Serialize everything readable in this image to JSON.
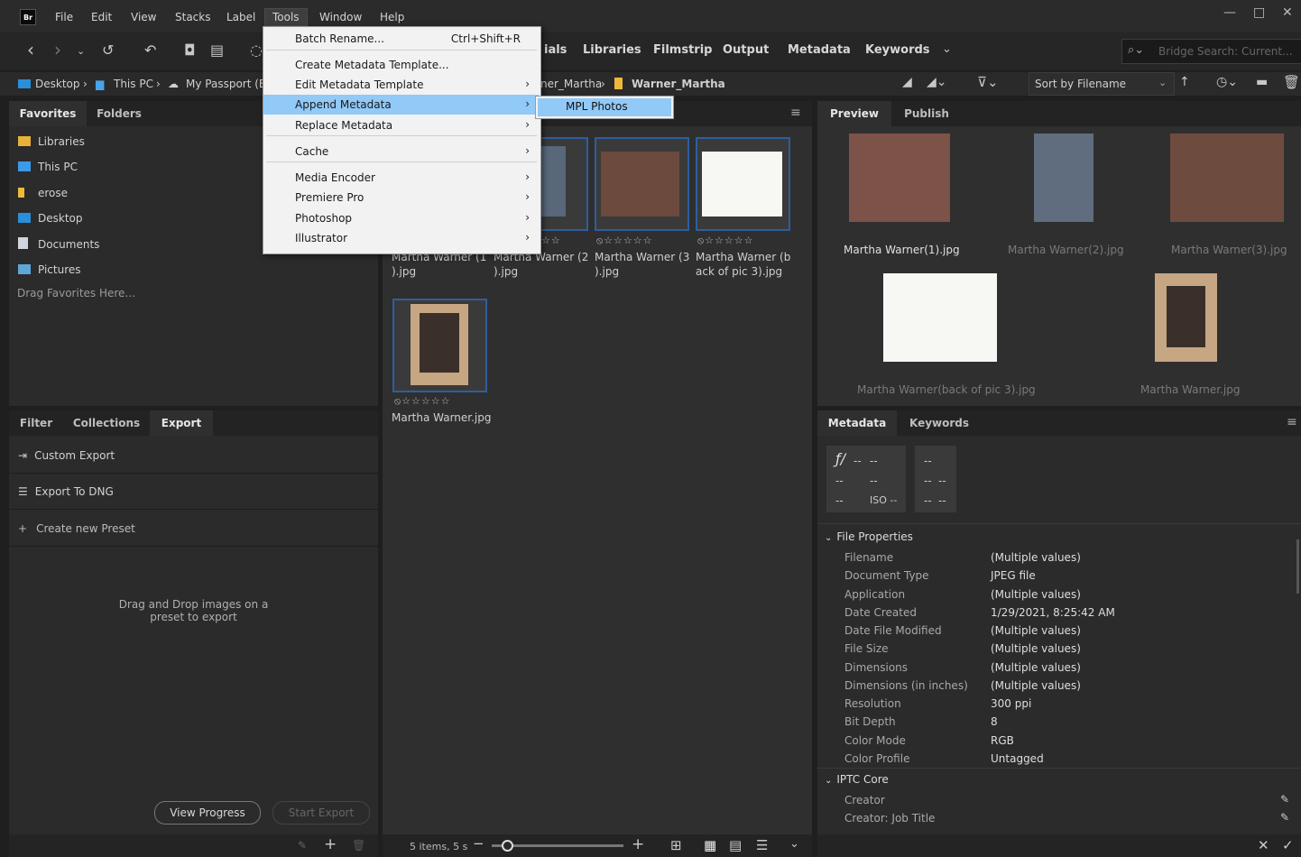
{
  "menubar": {
    "logo": "Br",
    "items": [
      "File",
      "Edit",
      "View",
      "Stacks",
      "Label",
      "Tools",
      "Window",
      "Help"
    ],
    "window_controls": [
      "—",
      "□",
      "✕"
    ]
  },
  "toolbar": {
    "workspaces": [
      "ials",
      "Libraries",
      "Filmstrip",
      "Output",
      "Metadata",
      "Keywords"
    ],
    "search_placeholder": "Bridge Search: Current..."
  },
  "path": {
    "left": [
      "Desktop",
      "This PC",
      "My Passport (E:"
    ],
    "right": [
      "ner_Martha",
      "Warner_Martha"
    ],
    "sort": "Sort by Filename"
  },
  "favorites_panel": {
    "tabs": [
      "Favorites",
      "Folders"
    ],
    "items": [
      "Libraries",
      "This PC",
      "erose",
      "Desktop",
      "Documents",
      "Pictures"
    ],
    "hint": "Drag Favorites Here..."
  },
  "export_panel": {
    "tabs": [
      "Filter",
      "Collections",
      "Export"
    ],
    "items": [
      "Custom Export",
      "Export To DNG",
      "Create new Preset"
    ],
    "drop_hint_1": "Drag and Drop images on a",
    "drop_hint_2": "preset to export",
    "view_progress": "View Progress",
    "start_export": "Start Export"
  },
  "content": {
    "rating": "⦸☆☆☆☆☆",
    "captions": [
      [
        "Martha Warner (1",
        ").jpg"
      ],
      [
        "Martha Warner (2",
        ").jpg"
      ],
      [
        "Martha Warner (3",
        ").jpg"
      ],
      [
        "Martha Warner (b",
        "ack of pic 3).jpg"
      ],
      [
        "Martha Warner.jpg",
        ""
      ]
    ],
    "status": "5 items, 5 s"
  },
  "tools_menu": {
    "items": [
      {
        "label": "Batch Rename...",
        "shortcut": "Ctrl+Shift+R",
        "arrow": ""
      },
      {
        "label": "Create Metadata Template...",
        "shortcut": "",
        "arrow": ""
      },
      {
        "label": "Edit Metadata Template",
        "shortcut": "",
        "arrow": "›"
      },
      {
        "label": "Append Metadata",
        "shortcut": "",
        "arrow": "›"
      },
      {
        "label": "Replace Metadata",
        "shortcut": "",
        "arrow": "›"
      },
      {
        "label": "Cache",
        "shortcut": "",
        "arrow": "›"
      },
      {
        "label": "Media Encoder",
        "shortcut": "",
        "arrow": "›"
      },
      {
        "label": "Premiere Pro",
        "shortcut": "",
        "arrow": "›"
      },
      {
        "label": "Photoshop",
        "shortcut": "",
        "arrow": "›"
      },
      {
        "label": "Illustrator",
        "shortcut": "",
        "arrow": "›"
      }
    ],
    "submenu_item": "MPL Photos"
  },
  "preview_panel": {
    "tabs": [
      "Preview",
      "Publish"
    ],
    "captions": [
      "Martha Warner(1).jpg",
      "Martha Warner(2).jpg",
      "Martha Warner(3).jpg",
      "Martha Warner(back of pic 3).jpg",
      "Martha Warner.jpg"
    ]
  },
  "metadata_panel": {
    "tabs": [
      "Metadata",
      "Keywords"
    ],
    "camera": {
      "f": "ƒ/",
      "dash": "--",
      "iso": "ISO --"
    },
    "file_properties_title": "File Properties",
    "rows": [
      [
        "Filename",
        "(Multiple values)"
      ],
      [
        "Document Type",
        "JPEG file"
      ],
      [
        "Application",
        "(Multiple values)"
      ],
      [
        "Date Created",
        "1/29/2021, 8:25:42 AM"
      ],
      [
        "Date File Modified",
        "(Multiple values)"
      ],
      [
        "File Size",
        "(Multiple values)"
      ],
      [
        "Dimensions",
        "(Multiple values)"
      ],
      [
        "Dimensions (in inches)",
        "(Multiple values)"
      ],
      [
        "Resolution",
        "300 ppi"
      ],
      [
        "Bit Depth",
        "8"
      ],
      [
        "Color Mode",
        "RGB"
      ],
      [
        "Color Profile",
        "Untagged"
      ]
    ],
    "iptc_title": "IPTC Core",
    "iptc_rows": [
      "Creator",
      "Creator: Job Title"
    ]
  }
}
